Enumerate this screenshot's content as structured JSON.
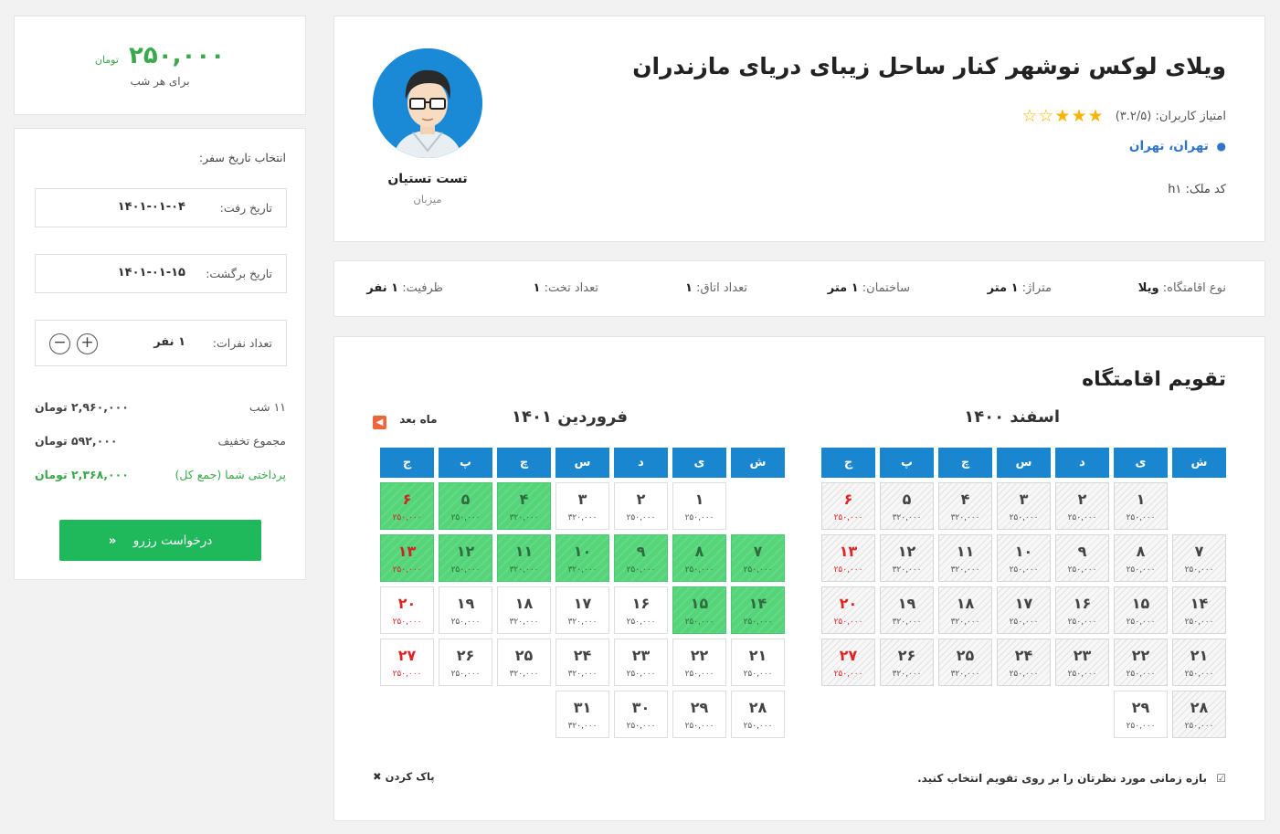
{
  "price_card": {
    "amount": "۲۵۰,۰۰۰",
    "unit": "تومان",
    "per_night": "برای هر شب"
  },
  "booking": {
    "heading": "انتخاب تاریخ سفر:",
    "depart_label": "تاریخ رفت:",
    "depart_value": "۱۴۰۱-۰۱-۰۴",
    "return_label": "تاریخ برگشت:",
    "return_value": "۱۴۰۱-۰۱-۱۵",
    "guests_label": "تعداد نفرات:",
    "guests_value": "۱ نفر",
    "plus": "+",
    "minus": "−",
    "nights_label": "۱۱ شب",
    "nights_value": "۲,۹۶۰,۰۰۰ تومان",
    "discount_label": "مجموع تخفیف",
    "discount_value": "۵۹۲,۰۰۰ تومان",
    "total_label": "پرداختی شما (جمع کل)",
    "total_value": "۲,۳۶۸,۰۰۰ تومان",
    "reserve_label": "درخواست رزرو",
    "reserve_arrow": "«"
  },
  "listing": {
    "title": "ویلای لوکس نوشهر کنار ساحل زیبای دریای مازندران",
    "rating_label": "امتیاز کاربران: (۳.۲/۵)",
    "stars_full": 3,
    "stars_total": 5,
    "location": "تهران، تهران",
    "code_label": "کد ملک:",
    "code_value": "h۱",
    "host_name": "تست تستیان",
    "host_role": "میزبان"
  },
  "specs": [
    {
      "label": "نوع اقامتگاه:",
      "value": "ویلا"
    },
    {
      "label": "متراژ:",
      "value": "۱ متر"
    },
    {
      "label": "ساختمان:",
      "value": "۱ متر"
    },
    {
      "label": "تعداد اتاق:",
      "value": "۱"
    },
    {
      "label": "تعداد تخت:",
      "value": "۱"
    },
    {
      "label": "ظرفیت:",
      "value": "۱ نفر"
    }
  ],
  "calendar": {
    "title": "تقویم اقامتگاه",
    "next_label": "ماه بعد",
    "weekdays": [
      "ش",
      "ی",
      "د",
      "س",
      "چ",
      "پ",
      "ج"
    ],
    "months": [
      {
        "title": "اسفند ۱۴۰۰",
        "offset": 1,
        "days": [
          {
            "n": "۱",
            "p": "۲۵۰,۰۰۰",
            "s": "past"
          },
          {
            "n": "۲",
            "p": "۲۵۰,۰۰۰",
            "s": "past"
          },
          {
            "n": "۳",
            "p": "۲۵۰,۰۰۰",
            "s": "past"
          },
          {
            "n": "۴",
            "p": "۳۲۰,۰۰۰",
            "s": "past"
          },
          {
            "n": "۵",
            "p": "۳۲۰,۰۰۰",
            "s": "past"
          },
          {
            "n": "۶",
            "p": "۲۵۰,۰۰۰",
            "s": "past"
          },
          {
            "n": "۷",
            "p": "۲۵۰,۰۰۰",
            "s": "past"
          },
          {
            "n": "۸",
            "p": "۲۵۰,۰۰۰",
            "s": "past"
          },
          {
            "n": "۹",
            "p": "۲۵۰,۰۰۰",
            "s": "past"
          },
          {
            "n": "۱۰",
            "p": "۲۵۰,۰۰۰",
            "s": "past"
          },
          {
            "n": "۱۱",
            "p": "۳۲۰,۰۰۰",
            "s": "past"
          },
          {
            "n": "۱۲",
            "p": "۳۲۰,۰۰۰",
            "s": "past"
          },
          {
            "n": "۱۳",
            "p": "۲۵۰,۰۰۰",
            "s": "past"
          },
          {
            "n": "۱۴",
            "p": "۲۵۰,۰۰۰",
            "s": "past"
          },
          {
            "n": "۱۵",
            "p": "۲۵۰,۰۰۰",
            "s": "past"
          },
          {
            "n": "۱۶",
            "p": "۲۵۰,۰۰۰",
            "s": "past"
          },
          {
            "n": "۱۷",
            "p": "۲۵۰,۰۰۰",
            "s": "past"
          },
          {
            "n": "۱۸",
            "p": "۳۲۰,۰۰۰",
            "s": "past"
          },
          {
            "n": "۱۹",
            "p": "۳۲۰,۰۰۰",
            "s": "past"
          },
          {
            "n": "۲۰",
            "p": "۲۵۰,۰۰۰",
            "s": "past"
          },
          {
            "n": "۲۱",
            "p": "۲۵۰,۰۰۰",
            "s": "past"
          },
          {
            "n": "۲۲",
            "p": "۲۵۰,۰۰۰",
            "s": "past"
          },
          {
            "n": "۲۳",
            "p": "۲۵۰,۰۰۰",
            "s": "past"
          },
          {
            "n": "۲۴",
            "p": "۲۵۰,۰۰۰",
            "s": "past"
          },
          {
            "n": "۲۵",
            "p": "۳۲۰,۰۰۰",
            "s": "past"
          },
          {
            "n": "۲۶",
            "p": "۳۲۰,۰۰۰",
            "s": "past"
          },
          {
            "n": "۲۷",
            "p": "۲۵۰,۰۰۰",
            "s": "past"
          },
          {
            "n": "۲۸",
            "p": "۲۵۰,۰۰۰",
            "s": "past"
          },
          {
            "n": "۲۹",
            "p": "۲۵۰,۰۰۰",
            "s": ""
          }
        ]
      },
      {
        "title": "فروردین ۱۴۰۱",
        "offset": 1,
        "days": [
          {
            "n": "۱",
            "p": "۲۵۰,۰۰۰",
            "s": ""
          },
          {
            "n": "۲",
            "p": "۲۵۰,۰۰۰",
            "s": ""
          },
          {
            "n": "۳",
            "p": "۳۲۰,۰۰۰",
            "s": ""
          },
          {
            "n": "۴",
            "p": "۳۲۰,۰۰۰",
            "s": "sel"
          },
          {
            "n": "۵",
            "p": "۲۵۰,۰۰۰",
            "s": "sel"
          },
          {
            "n": "۶",
            "p": "۲۵۰,۰۰۰",
            "s": "sel"
          },
          {
            "n": "۷",
            "p": "۲۵۰,۰۰۰",
            "s": "sel"
          },
          {
            "n": "۸",
            "p": "۲۵۰,۰۰۰",
            "s": "sel"
          },
          {
            "n": "۹",
            "p": "۲۵۰,۰۰۰",
            "s": "sel"
          },
          {
            "n": "۱۰",
            "p": "۳۲۰,۰۰۰",
            "s": "sel"
          },
          {
            "n": "۱۱",
            "p": "۳۲۰,۰۰۰",
            "s": "sel"
          },
          {
            "n": "۱۲",
            "p": "۲۵۰,۰۰۰",
            "s": "sel"
          },
          {
            "n": "۱۳",
            "p": "۲۵۰,۰۰۰",
            "s": "sel"
          },
          {
            "n": "۱۴",
            "p": "۲۵۰,۰۰۰",
            "s": "sel"
          },
          {
            "n": "۱۵",
            "p": "۲۵۰,۰۰۰",
            "s": "sel"
          },
          {
            "n": "۱۶",
            "p": "۲۵۰,۰۰۰",
            "s": ""
          },
          {
            "n": "۱۷",
            "p": "۳۲۰,۰۰۰",
            "s": ""
          },
          {
            "n": "۱۸",
            "p": "۳۲۰,۰۰۰",
            "s": ""
          },
          {
            "n": "۱۹",
            "p": "۲۵۰,۰۰۰",
            "s": ""
          },
          {
            "n": "۲۰",
            "p": "۲۵۰,۰۰۰",
            "s": ""
          },
          {
            "n": "۲۱",
            "p": "۲۵۰,۰۰۰",
            "s": ""
          },
          {
            "n": "۲۲",
            "p": "۲۵۰,۰۰۰",
            "s": ""
          },
          {
            "n": "۲۳",
            "p": "۲۵۰,۰۰۰",
            "s": ""
          },
          {
            "n": "۲۴",
            "p": "۳۲۰,۰۰۰",
            "s": ""
          },
          {
            "n": "۲۵",
            "p": "۳۲۰,۰۰۰",
            "s": ""
          },
          {
            "n": "۲۶",
            "p": "۲۵۰,۰۰۰",
            "s": ""
          },
          {
            "n": "۲۷",
            "p": "۲۵۰,۰۰۰",
            "s": ""
          },
          {
            "n": "۲۸",
            "p": "۲۵۰,۰۰۰",
            "s": ""
          },
          {
            "n": "۲۹",
            "p": "۲۵۰,۰۰۰",
            "s": ""
          },
          {
            "n": "۳۰",
            "p": "۲۵۰,۰۰۰",
            "s": ""
          },
          {
            "n": "۳۱",
            "p": "۳۲۰,۰۰۰",
            "s": ""
          }
        ]
      }
    ],
    "hint": "بازه زمانی مورد نظرتان را بر روی تقویم انتخاب کنید.",
    "clear_label": "پاک کردن",
    "clear_icon": "✖"
  },
  "colors": {
    "accent_blue": "#1a86d0",
    "green": "#1fb85a",
    "red": "#e02424",
    "star": "#f7b500"
  }
}
